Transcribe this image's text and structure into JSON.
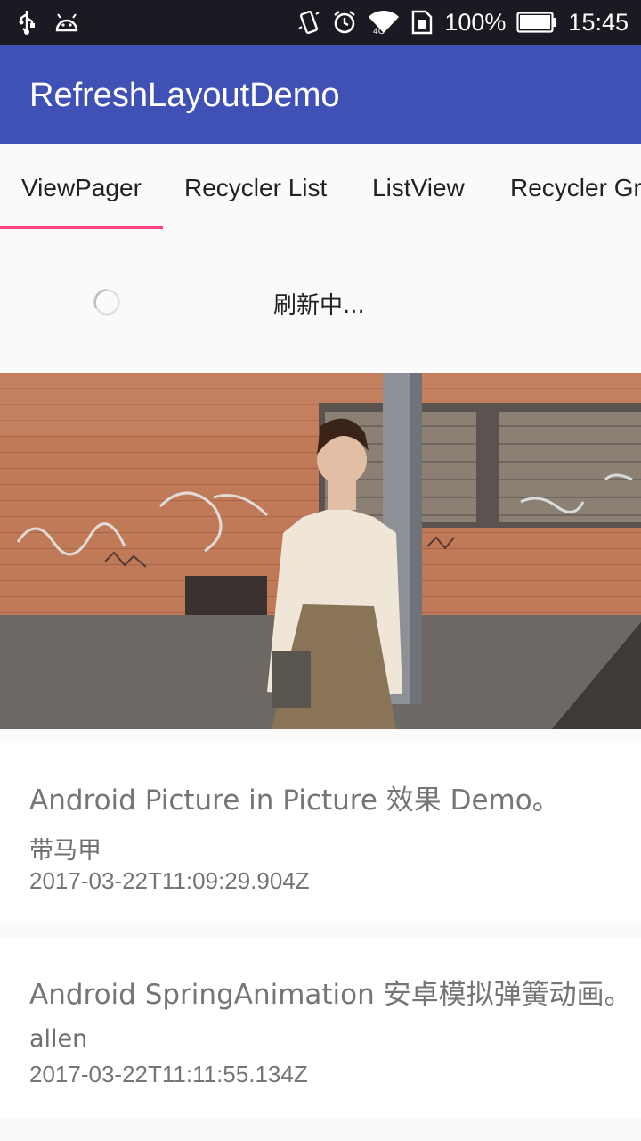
{
  "status_bar": {
    "battery_percent": "100%",
    "time": "15:45",
    "icons": [
      "usb-icon",
      "android-debug-icon",
      "vibrate-icon",
      "alarm-icon",
      "wifi-icon",
      "sim-icon",
      "battery-icon"
    ]
  },
  "app_bar": {
    "title": "RefreshLayoutDemo",
    "color": "#3f51b5"
  },
  "tabs": [
    {
      "label": "ViewPager",
      "selected": true
    },
    {
      "label": "Recycler List",
      "selected": false
    },
    {
      "label": "ListView",
      "selected": false
    },
    {
      "label": "Recycler Gr",
      "selected": false
    }
  ],
  "tab_indicator_color": "#ff4081",
  "refresh": {
    "text": "刷新中..."
  },
  "feed": [
    {
      "title": "Android Picture in Picture 效果 Demo。",
      "author": "带马甲",
      "date": "2017-03-22T11:09:29.904Z"
    },
    {
      "title": "Android SpringAnimation 安卓模拟弹簧动画。",
      "author": "allen",
      "date": "2017-03-22T11:11:55.134Z"
    }
  ]
}
